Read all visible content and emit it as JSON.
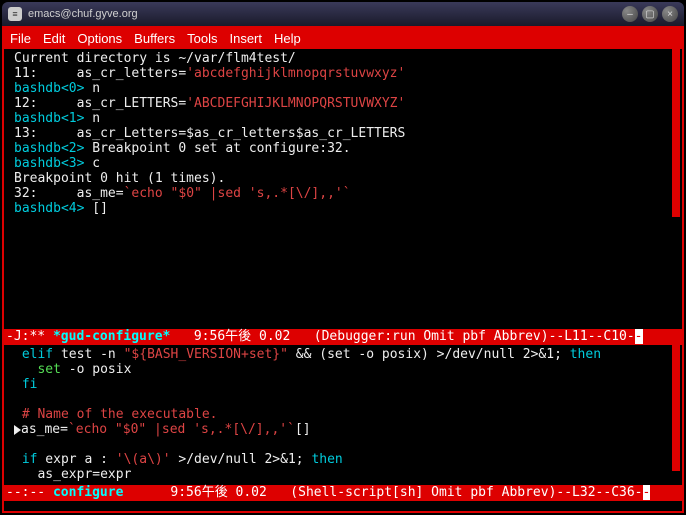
{
  "window": {
    "title": "emacs@chuf.gyve.org"
  },
  "menu": {
    "file": "File",
    "edit": "Edit",
    "options": "Options",
    "buffers": "Buffers",
    "tools": "Tools",
    "insert": "Insert",
    "help": "Help"
  },
  "top_buffer": {
    "l1": "Current directory is ~/var/flm4test/",
    "l2a": "11:     as_cr_letters=",
    "l2b": "'abcdefghijklmnopqrstuvwxyz'",
    "l3a": "bashdb<0>",
    "l3b": " n",
    "l4a": "12:     as_cr_LETTERS=",
    "l4b": "'ABCDEFGHIJKLMNOPQRSTUVWXYZ'",
    "l5a": "bashdb<1>",
    "l5b": " n",
    "l6": "13:     as_cr_Letters=$as_cr_letters$as_cr_LETTERS",
    "l7a": "bashdb<2>",
    "l7b": " Breakpoint 0 set at configure:32.",
    "l8a": "bashdb<3>",
    "l8b": " c",
    "l9": "Breakpoint 0 hit (1 times).",
    "l10a": "32:     as_me=",
    "l10b": "`echo \"$0\" |sed 's,.*[\\/],,'`",
    "l11a": "bashdb<4>",
    "l11b": " ",
    "cursor": "[]"
  },
  "modeline1": {
    "left": "-J:** ",
    "buf": "*gud-configure*",
    "mid": "   9:56午後 0.02   (Debugger:run Omit pbf Abbrev)--L11--C10-",
    "tail": "-"
  },
  "bottom_buffer": {
    "l1a": " elif",
    "l1b": " test -n ",
    "l1c": "\"${BASH_VERSION+set}\"",
    "l1d": " && (set -o posix) >/dev/null 2>&1; ",
    "l1e": "then",
    "l2a": "   set",
    "l2b": " -o posix",
    "l3": " fi",
    "l4": " ",
    "l5": " # Name of the executable.",
    "l6a": "as_me=",
    "l6b": "`echo \"$0\" |sed 's,.*[\\/],,'`",
    "l6c": "[]",
    "l7": " ",
    "l8a": " if",
    "l8b": " expr a : ",
    "l8c": "'\\(a\\)'",
    "l8d": " >/dev/null 2>&1; ",
    "l8e": "then",
    "l9": "   as_expr=expr"
  },
  "modeline2": {
    "left": "--:-- ",
    "buf": "configure",
    "mid": "      9:56午後 0.02   (Shell-script[sh] Omit pbf Abbrev)--L32--C36-",
    "tail": "-"
  }
}
